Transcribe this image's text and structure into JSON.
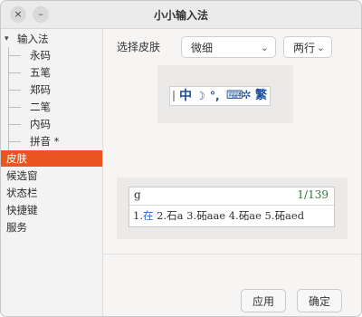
{
  "window": {
    "title": "小小输入法",
    "close_icon": "×",
    "minimize_icon": "–"
  },
  "sidebar": {
    "group_label": "输入法",
    "group_caret": "▾",
    "children": [
      "永码",
      "五笔",
      "郑码",
      "二笔",
      "内码",
      "拼音 *"
    ],
    "items": [
      "皮肤",
      "候选窗",
      "状态栏",
      "快捷键",
      "服务"
    ],
    "selected": "皮肤",
    "accent_color": "#e95420"
  },
  "skin": {
    "label": "选择皮肤",
    "skin_select": {
      "value": "微细",
      "chevron": "⌄"
    },
    "layout_select": {
      "value": "两行",
      "chevron": "⌄"
    }
  },
  "toolbar_preview": {
    "icons": [
      {
        "name": "chinese-mode-icon",
        "glyph": "中"
      },
      {
        "name": "moon-icon",
        "glyph": "☽"
      },
      {
        "name": "punctuation-icon",
        "glyph": "°,"
      },
      {
        "name": "keyboard-icon",
        "glyph": "⌨"
      },
      {
        "name": "gear-icon",
        "glyph": "✲"
      },
      {
        "name": "traditional-icon",
        "glyph": "繁"
      }
    ]
  },
  "candidate_preview": {
    "code": "g",
    "page": "1/139",
    "first_candidate": "1.在",
    "highlight_char": "在",
    "rest": "2.石a 3.砳aae 4.砳ae 5.砳aed"
  },
  "buttons": {
    "apply": "应用",
    "ok": "确定"
  }
}
